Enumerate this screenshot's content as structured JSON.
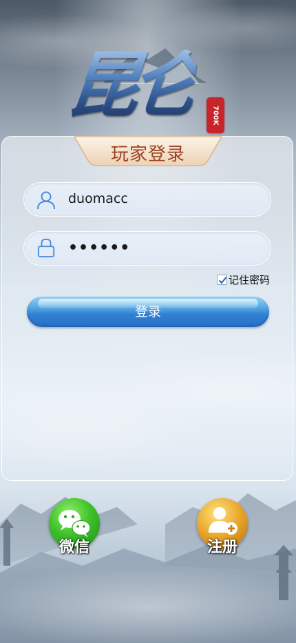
{
  "logo": {
    "text": "昆仑",
    "seal_text": "700K"
  },
  "login_panel": {
    "title": "玩家登录",
    "username": {
      "value": "duomacc",
      "icon": "user-icon"
    },
    "password": {
      "value": "••••••",
      "icon": "lock-icon"
    },
    "remember_password": {
      "label": "记住密码",
      "checked": true
    },
    "login_button": "登录"
  },
  "bottom_actions": {
    "wechat": {
      "label": "微信",
      "icon": "wechat-icon",
      "color": "#3fc12a"
    },
    "register": {
      "label": "注册",
      "icon": "add-user-icon",
      "color": "#e7a52a"
    }
  },
  "colors": {
    "login_button": "#2f7fd2",
    "title_text": "#9a4322",
    "seal": "#c7252b"
  }
}
